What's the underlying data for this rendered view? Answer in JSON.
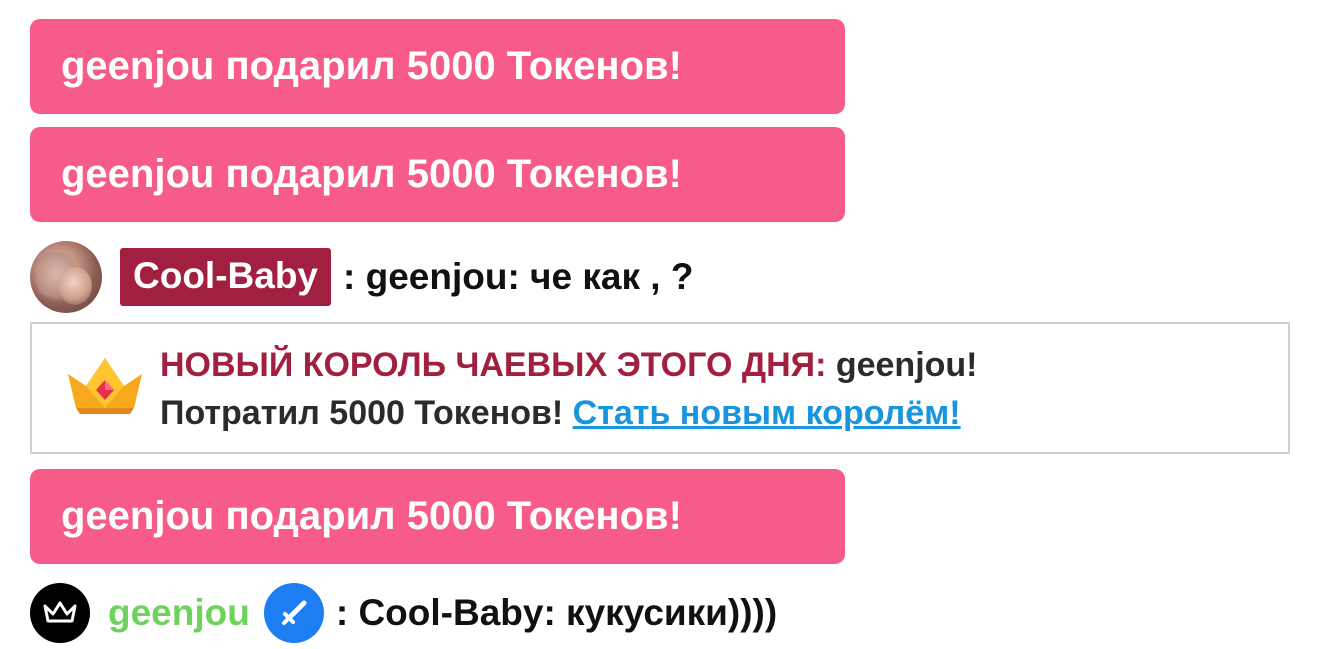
{
  "chat": {
    "top_partial": {
      "icon": "coin-icon",
      "color": "#f5c018"
    },
    "tip_messages": [
      "geenjou подарил 5000 Токенов!",
      "geenjou подарил 5000 Токенов!",
      "geenjou подарил 5000 Токенов!"
    ],
    "message1": {
      "username": "Cool-Baby",
      "text": ": geenjou: че как , ?",
      "badge_color": "#a1203f"
    },
    "king_notice": {
      "title": "НОВЫЙ КОРОЛЬ ЧАЕВЫХ ЭТОГО ДНЯ:",
      "name": "geenjou!",
      "spent": "Потратил 5000 Токенов!",
      "link": "Стать новым королём!",
      "icon": "crown-icon"
    },
    "message2": {
      "username": "geenjou",
      "text": ": Cool-Baby: кукусики))))",
      "avatar_icon": "crown-icon",
      "badge_icon": "verified-sword-icon",
      "name_color": "#6dd35c"
    }
  },
  "colors": {
    "tip_background": "#f65b89",
    "link": "#1795df",
    "title": "#a1203f"
  }
}
